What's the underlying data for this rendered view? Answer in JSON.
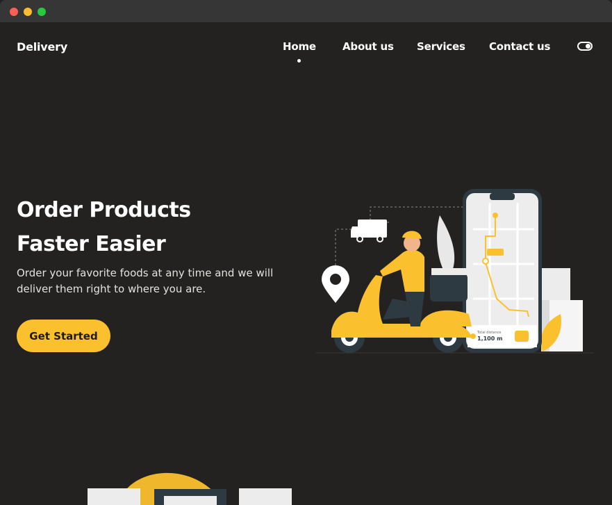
{
  "window": {
    "controls": [
      "close",
      "minimize",
      "maximize"
    ]
  },
  "nav": {
    "logo": "Delivery",
    "links": [
      "Home",
      "About us",
      "Services",
      "Contact us"
    ],
    "active": "Home"
  },
  "hero": {
    "title_line1": "Order Products",
    "title_line2": "Faster Easier",
    "description": "Order your favorite foods at any time and we will deliver them right to where you are.",
    "cta_label": "Get Started"
  },
  "illustration": {
    "phone_distance_label": "Total distance",
    "phone_distance_value": "1,100 m"
  },
  "colors": {
    "background": "#242220",
    "accent": "#fbc02d",
    "text": "#ffffff"
  }
}
